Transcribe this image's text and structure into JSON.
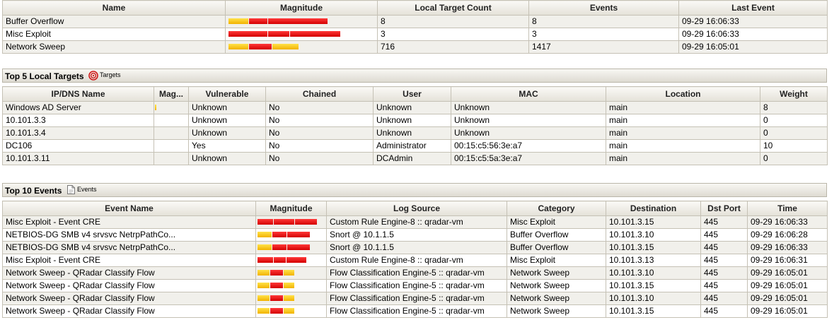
{
  "categories_table": {
    "headers": [
      "Name",
      "Magnitude",
      "Local Target Count",
      "Events",
      "Last Event"
    ],
    "rows": [
      {
        "name": "Buffer Overflow",
        "targets": "8",
        "events": "8",
        "last": "09-29 16:06:33",
        "magnitude": [
          [
            "y",
            28
          ],
          [
            "r",
            26
          ],
          [
            "r",
            84
          ]
        ]
      },
      {
        "name": "Misc Exploit",
        "targets": "3",
        "events": "3",
        "last": "09-29 16:06:33",
        "magnitude": [
          [
            "r",
            55
          ],
          [
            "r",
            30
          ],
          [
            "r",
            71
          ]
        ]
      },
      {
        "name": "Network Sweep",
        "targets": "716",
        "events": "1417",
        "last": "09-29 16:05:01",
        "magnitude": [
          [
            "y",
            28
          ],
          [
            "r",
            32
          ],
          [
            "y",
            37
          ]
        ]
      }
    ]
  },
  "targets_section": {
    "title": "Top 5 Local Targets",
    "link": "Targets"
  },
  "targets_table": {
    "headers": [
      "IP/DNS Name",
      "Mag...",
      "Vulnerable",
      "Chained",
      "User",
      "MAC",
      "Location",
      "Weight"
    ],
    "rows": [
      {
        "name": "Windows AD Server",
        "vulnerable": "Unknown",
        "chained": "No",
        "user": "Unknown",
        "mac": "Unknown",
        "location": "main",
        "weight": "8",
        "magnitude": [
          [
            "y",
            2
          ]
        ]
      },
      {
        "name": "10.101.3.3",
        "vulnerable": "Unknown",
        "chained": "No",
        "user": "Unknown",
        "mac": "Unknown",
        "location": "main",
        "weight": "0",
        "magnitude": []
      },
      {
        "name": "10.101.3.4",
        "vulnerable": "Unknown",
        "chained": "No",
        "user": "Unknown",
        "mac": "Unknown",
        "location": "main",
        "weight": "0",
        "magnitude": []
      },
      {
        "name": "DC106",
        "vulnerable": "Yes",
        "chained": "No",
        "user": "Administrator",
        "mac": "00:15:c5:56:3e:a7",
        "location": "main",
        "weight": "10",
        "magnitude": []
      },
      {
        "name": "10.101.3.11",
        "vulnerable": "Unknown",
        "chained": "No",
        "user": "DCAdmin",
        "mac": "00:15:c5:5a:3e:a7",
        "location": "main",
        "weight": "0",
        "magnitude": []
      }
    ]
  },
  "events_section": {
    "title": "Top 10 Events",
    "link": "Events"
  },
  "events_table": {
    "headers": [
      "Event Name",
      "Magnitude",
      "Log Source",
      "Category",
      "Destination",
      "Dst Port",
      "Time"
    ],
    "rows": [
      {
        "name": "Misc Exploit - Event CRE",
        "source": "Custom Rule Engine-8 :: qradar-vm",
        "category": "Misc Exploit",
        "dest": "10.101.3.15",
        "port": "445",
        "time": "09-29 16:06:33",
        "magnitude": [
          [
            "r",
            22
          ],
          [
            "r",
            29
          ],
          [
            "r",
            31
          ]
        ]
      },
      {
        "name": "NETBIOS-DG SMB v4 srvsvc NetrpPathCo...",
        "source": "Snort @ 10.1.1.5",
        "category": "Buffer Overflow",
        "dest": "10.101.3.10",
        "port": "445",
        "time": "09-29 16:06:28",
        "magnitude": [
          [
            "y",
            20
          ],
          [
            "r",
            20
          ],
          [
            "r",
            32
          ]
        ]
      },
      {
        "name": "NETBIOS-DG SMB v4 srvsvc NetrpPathCo...",
        "source": "Snort @ 10.1.1.5",
        "category": "Buffer Overflow",
        "dest": "10.101.3.15",
        "port": "445",
        "time": "09-29 16:06:33",
        "magnitude": [
          [
            "y",
            20
          ],
          [
            "r",
            20
          ],
          [
            "r",
            32
          ]
        ]
      },
      {
        "name": "Misc Exploit - Event CRE",
        "source": "Custom Rule Engine-8 :: qradar-vm",
        "category": "Misc Exploit",
        "dest": "10.101.3.13",
        "port": "445",
        "time": "09-29 16:06:31",
        "magnitude": [
          [
            "r",
            22
          ],
          [
            "r",
            17
          ],
          [
            "r",
            28
          ]
        ]
      },
      {
        "name": "Network Sweep - QRadar Classify Flow",
        "source": "Flow Classification Engine-5 :: qradar-vm",
        "category": "Network Sweep",
        "dest": "10.101.3.10",
        "port": "445",
        "time": "09-29 16:05:01",
        "magnitude": [
          [
            "y",
            17
          ],
          [
            "r",
            18
          ],
          [
            "y",
            15
          ]
        ]
      },
      {
        "name": "Network Sweep - QRadar Classify Flow",
        "source": "Flow Classification Engine-5 :: qradar-vm",
        "category": "Network Sweep",
        "dest": "10.101.3.15",
        "port": "445",
        "time": "09-29 16:05:01",
        "magnitude": [
          [
            "y",
            17
          ],
          [
            "r",
            18
          ],
          [
            "y",
            15
          ]
        ]
      },
      {
        "name": "Network Sweep - QRadar Classify Flow",
        "source": "Flow Classification Engine-5 :: qradar-vm",
        "category": "Network Sweep",
        "dest": "10.101.3.10",
        "port": "445",
        "time": "09-29 16:05:01",
        "magnitude": [
          [
            "y",
            17
          ],
          [
            "r",
            18
          ],
          [
            "y",
            15
          ]
        ]
      },
      {
        "name": "Network Sweep - QRadar Classify Flow",
        "source": "Flow Classification Engine-5 :: qradar-vm",
        "category": "Network Sweep",
        "dest": "10.101.3.15",
        "port": "445",
        "time": "09-29 16:05:01",
        "magnitude": [
          [
            "y",
            17
          ],
          [
            "r",
            18
          ],
          [
            "y",
            15
          ]
        ]
      }
    ]
  }
}
